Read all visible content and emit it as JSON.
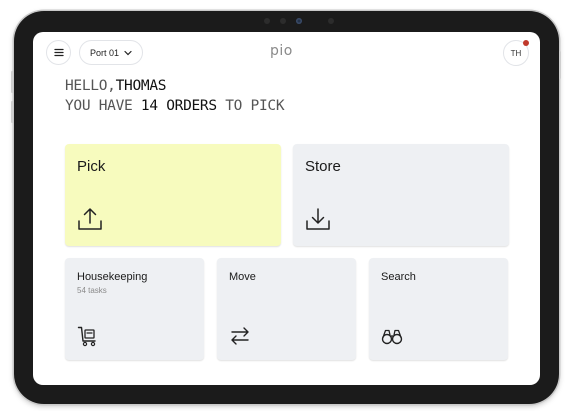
{
  "header": {
    "menu_icon": "hamburger-menu-icon",
    "port_label": "Port 01",
    "logo_text": "pio",
    "avatar_initials": "TH",
    "notification_color": "#c0392b"
  },
  "greeting": {
    "line1_prefix": "HELLO,",
    "line1_name": "THOMAS",
    "line2_prefix": "YOU HAVE",
    "line2_count": "14",
    "line2_word": "ORDERS",
    "line2_suffix": "TO PICK"
  },
  "tiles": {
    "pick": {
      "label": "Pick",
      "icon": "upload-icon",
      "color": "#f7fbbe"
    },
    "store": {
      "label": "Store",
      "icon": "download-icon",
      "color": "#eef0f3"
    },
    "housekeeping": {
      "label": "Housekeeping",
      "subtitle": "54 tasks",
      "icon": "cart-icon"
    },
    "move": {
      "label": "Move",
      "icon": "swap-arrows-icon"
    },
    "search": {
      "label": "Search",
      "icon": "binoculars-icon"
    }
  }
}
